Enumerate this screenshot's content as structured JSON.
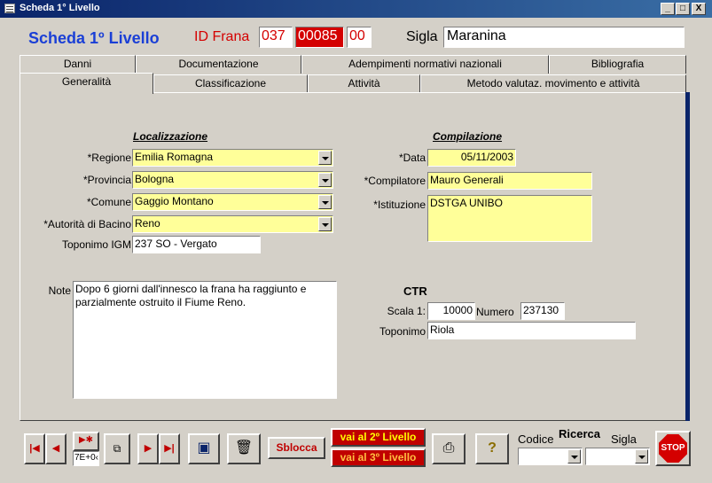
{
  "window": {
    "title": "Scheda 1° Livello",
    "controls": [
      "_",
      "□",
      "X"
    ]
  },
  "header": {
    "title": "Scheda 1º Livello",
    "id_label": "ID Frana",
    "id_part1": "037",
    "id_part2": "00085",
    "id_part3": "00",
    "sigla_label": "Sigla",
    "sigla_value": "Maranina"
  },
  "tabs_row1": [
    "Danni",
    "Documentazione",
    "Adempimenti normativi nazionali",
    "Bibliografia"
  ],
  "tabs_row2": [
    "Generalità",
    "Classificazione",
    "Attività",
    "Metodo valutaz. movimento e attività"
  ],
  "localizzazione": {
    "heading": "Localizzazione",
    "regione_label": "*Regione",
    "regione": "Emilia Romagna",
    "provincia_label": "*Provincia",
    "provincia": "Bologna",
    "comune_label": "*Comune",
    "comune": "Gaggio Montano",
    "autorita_label": "*Autorità di Bacino",
    "autorita": "Reno",
    "toponimo_label": "Toponimo IGM",
    "toponimo": "237 SO - Vergato"
  },
  "compilazione": {
    "heading": "Compilazione",
    "data_label": "*Data",
    "data": "05/11/2003",
    "compilatore_label": "*Compilatore",
    "compilatore": "Mauro Generali",
    "istituzione_label": "*Istituzione",
    "istituzione": "DSTGA UNIBO"
  },
  "note": {
    "label": "Note",
    "text": "Dopo 6 giorni dall'innesco la frana ha raggiunto e parzialmente ostruito il Fiume Reno."
  },
  "ctr": {
    "heading": "CTR",
    "scala_label": "Scala 1:",
    "scala": "10000",
    "numero_label": "Numero",
    "numero": "237130",
    "toponimo_label": "Toponimo",
    "toponimo": "Riola"
  },
  "toolbar": {
    "record_field": "7E+0‹",
    "sblocca": "Sblocca",
    "vai2": "vai al 2º Livello",
    "vai3": "vai al 3º Livello",
    "codice_label": "Codice",
    "ricerca_label": "Ricerca",
    "sigla_label": "Sigla",
    "stop_label": "STOP"
  },
  "icons": [
    "first-record-icon",
    "prev-record-icon",
    "new-record-icon",
    "find-icon",
    "next-record-icon",
    "last-record-icon",
    "save-icon",
    "delete-icon",
    "print-icon",
    "help-icon",
    "stop-icon"
  ],
  "colors": {
    "accent_blue": "#1a3fd6",
    "accent_red": "#d40000",
    "field_yellow": "#ffff99",
    "face": "#d4d0c8"
  }
}
